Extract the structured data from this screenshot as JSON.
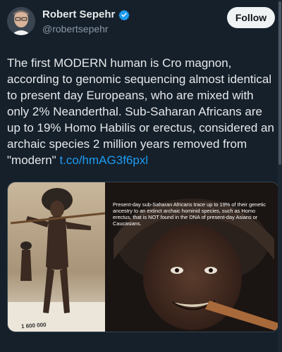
{
  "author": {
    "name": "Robert Sepehr",
    "handle": "@robertsepehr"
  },
  "follow_label": "Follow",
  "tweet": {
    "text": "The first MODERN human is Cro magnon, according to genomic sequencing almost identical to present day Europeans, who are mixed with only 2% Neanderthal. Sub-Saharan Africans are up to 19% Homo Habilis or erectus, considered an archaic species 2 million years removed from \"modern\" ",
    "link": "t.co/hmAG3f6pxl"
  },
  "media": {
    "caption": "Present-day sub-Saharan Africans trace up to 19% of their genetic ancestry to an extinct archaic hominid species, such as Homo erectus, that is NOT found in the DNA of present-day Asians or Caucasians.",
    "museum_label": "1 600 000"
  },
  "colors": {
    "background": "#15202b",
    "accent": "#1d9bf0",
    "verified": "#1d9bf0"
  },
  "icons": [
    "verified-badge-icon"
  ]
}
